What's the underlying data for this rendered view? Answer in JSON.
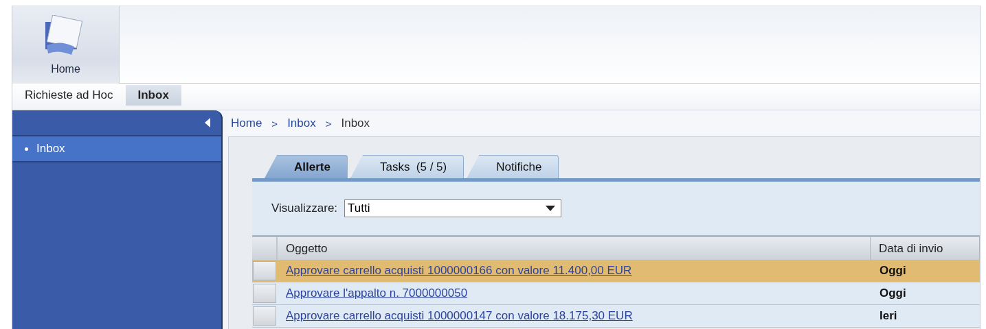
{
  "header": {
    "home_tile": "Home"
  },
  "nav_tabs": [
    {
      "label": "Richieste ad Hoc",
      "selected": false
    },
    {
      "label": "Inbox",
      "selected": true
    }
  ],
  "sidebar": {
    "items": [
      {
        "label": "Inbox",
        "selected": true
      }
    ]
  },
  "breadcrumb": [
    "Home",
    "Inbox",
    "Inbox"
  ],
  "breadcrumb_separator": ">",
  "tabs": [
    {
      "label": "Allerte",
      "selected": true
    },
    {
      "label": "Tasks  (5 / 5)",
      "selected": false
    },
    {
      "label": "Notifiche",
      "selected": false
    }
  ],
  "filter": {
    "label": "Visualizzare:",
    "value": "Tutti"
  },
  "table": {
    "columns": [
      "Oggetto",
      "Data di invio"
    ],
    "rows": [
      {
        "subject": "Approvare carrello acquisti 1000000166 con valore 11.400,00 EUR",
        "date": "Oggi",
        "selected": true
      },
      {
        "subject": "Approvare l'appalto n. 7000000050",
        "date": "Oggi",
        "selected": false
      },
      {
        "subject": "Approvare carrello acquisti 1000000147 con valore 18.175,30 EUR",
        "date": "Ieri",
        "selected": false
      }
    ]
  }
}
